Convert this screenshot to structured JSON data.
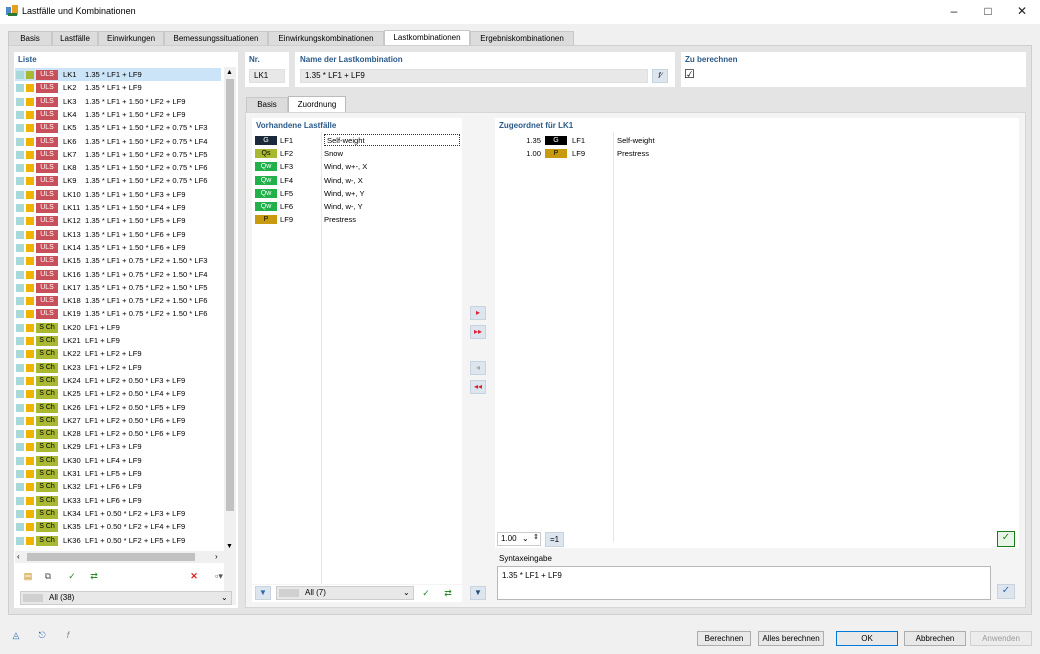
{
  "window": {
    "title": "Lastfälle und Kombinationen"
  },
  "tabs": [
    "Basis",
    "Lastfälle",
    "Einwirkungen",
    "Bemessungssituationen",
    "Einwirkungskombinationen",
    "Lastkombinationen",
    "Ergebniskombinationen"
  ],
  "list": {
    "header": "Liste",
    "items": [
      {
        "tag": "ULS",
        "name": "LK1",
        "formula": "1.35 * LF1 + LF9"
      },
      {
        "tag": "ULS",
        "name": "LK2",
        "formula": "1.35 * LF1 + LF9"
      },
      {
        "tag": "ULS",
        "name": "LK3",
        "formula": "1.35 * LF1 + 1.50 * LF2 + LF9"
      },
      {
        "tag": "ULS",
        "name": "LK4",
        "formula": "1.35 * LF1 + 1.50 * LF2 + LF9"
      },
      {
        "tag": "ULS",
        "name": "LK5",
        "formula": "1.35 * LF1 + 1.50 * LF2 + 0.75 * LF3"
      },
      {
        "tag": "ULS",
        "name": "LK6",
        "formula": "1.35 * LF1 + 1.50 * LF2 + 0.75 * LF4"
      },
      {
        "tag": "ULS",
        "name": "LK7",
        "formula": "1.35 * LF1 + 1.50 * LF2 + 0.75 * LF5"
      },
      {
        "tag": "ULS",
        "name": "LK8",
        "formula": "1.35 * LF1 + 1.50 * LF2 + 0.75 * LF6"
      },
      {
        "tag": "ULS",
        "name": "LK9",
        "formula": "1.35 * LF1 + 1.50 * LF2 + 0.75 * LF6"
      },
      {
        "tag": "ULS",
        "name": "LK10",
        "formula": "1.35 * LF1 + 1.50 * LF3 + LF9"
      },
      {
        "tag": "ULS",
        "name": "LK11",
        "formula": "1.35 * LF1 + 1.50 * LF4 + LF9"
      },
      {
        "tag": "ULS",
        "name": "LK12",
        "formula": "1.35 * LF1 + 1.50 * LF5 + LF9"
      },
      {
        "tag": "ULS",
        "name": "LK13",
        "formula": "1.35 * LF1 + 1.50 * LF6 + LF9"
      },
      {
        "tag": "ULS",
        "name": "LK14",
        "formula": "1.35 * LF1 + 1.50 * LF6 + LF9"
      },
      {
        "tag": "ULS",
        "name": "LK15",
        "formula": "1.35 * LF1 + 0.75 * LF2 + 1.50 * LF3"
      },
      {
        "tag": "ULS",
        "name": "LK16",
        "formula": "1.35 * LF1 + 0.75 * LF2 + 1.50 * LF4"
      },
      {
        "tag": "ULS",
        "name": "LK17",
        "formula": "1.35 * LF1 + 0.75 * LF2 + 1.50 * LF5"
      },
      {
        "tag": "ULS",
        "name": "LK18",
        "formula": "1.35 * LF1 + 0.75 * LF2 + 1.50 * LF6"
      },
      {
        "tag": "ULS",
        "name": "LK19",
        "formula": "1.35 * LF1 + 0.75 * LF2 + 1.50 * LF6"
      },
      {
        "tag": "S Ch",
        "name": "LK20",
        "formula": "LF1 + LF9"
      },
      {
        "tag": "S Ch",
        "name": "LK21",
        "formula": "LF1 + LF9"
      },
      {
        "tag": "S Ch",
        "name": "LK22",
        "formula": "LF1 + LF2 + LF9"
      },
      {
        "tag": "S Ch",
        "name": "LK23",
        "formula": "LF1 + LF2 + LF9"
      },
      {
        "tag": "S Ch",
        "name": "LK24",
        "formula": "LF1 + LF2 + 0.50 * LF3 + LF9"
      },
      {
        "tag": "S Ch",
        "name": "LK25",
        "formula": "LF1 + LF2 + 0.50 * LF4 + LF9"
      },
      {
        "tag": "S Ch",
        "name": "LK26",
        "formula": "LF1 + LF2 + 0.50 * LF5 + LF9"
      },
      {
        "tag": "S Ch",
        "name": "LK27",
        "formula": "LF1 + LF2 + 0.50 * LF6 + LF9"
      },
      {
        "tag": "S Ch",
        "name": "LK28",
        "formula": "LF1 + LF2 + 0.50 * LF6 + LF9"
      },
      {
        "tag": "S Ch",
        "name": "LK29",
        "formula": "LF1 + LF3 + LF9"
      },
      {
        "tag": "S Ch",
        "name": "LK30",
        "formula": "LF1 + LF4 + LF9"
      },
      {
        "tag": "S Ch",
        "name": "LK31",
        "formula": "LF1 + LF5 + LF9"
      },
      {
        "tag": "S Ch",
        "name": "LK32",
        "formula": "LF1 + LF6 + LF9"
      },
      {
        "tag": "S Ch",
        "name": "LK33",
        "formula": "LF1 + LF6 + LF9"
      },
      {
        "tag": "S Ch",
        "name": "LK34",
        "formula": "LF1 + 0.50 * LF2 + LF3 + LF9"
      },
      {
        "tag": "S Ch",
        "name": "LK35",
        "formula": "LF1 + 0.50 * LF2 + LF4 + LF9"
      },
      {
        "tag": "S Ch",
        "name": "LK36",
        "formula": "LF1 + 0.50 * LF2 + LF5 + LF9"
      }
    ],
    "filter": "All (38)"
  },
  "detail": {
    "nr_label": "Nr.",
    "nr_value": "LK1",
    "name_label": "Name der Lastkombination",
    "name_value": "1.35 * LF1 + LF9",
    "calc_label": "Zu berechnen",
    "calc_checked": "☑"
  },
  "subtabs": [
    "Basis",
    "Zuordnung"
  ],
  "available": {
    "header": "Vorhandene Lastfälle",
    "items": [
      {
        "tag": "G",
        "tagcolor": "#1a2a3a",
        "tagtext": "#fff",
        "lf": "LF1",
        "desc": "Self-weight"
      },
      {
        "tag": "Qs",
        "tagcolor": "#a8b830",
        "tagtext": "#000",
        "lf": "LF2",
        "desc": "Snow"
      },
      {
        "tag": "Qw",
        "tagcolor": "#22b04a",
        "tagtext": "#fff",
        "lf": "LF3",
        "desc": "Wind, w+-, X"
      },
      {
        "tag": "Qw",
        "tagcolor": "#22b04a",
        "tagtext": "#fff",
        "lf": "LF4",
        "desc": "Wind, w-, X"
      },
      {
        "tag": "Qw",
        "tagcolor": "#22b04a",
        "tagtext": "#fff",
        "lf": "LF5",
        "desc": "Wind, w+, Y"
      },
      {
        "tag": "Qw",
        "tagcolor": "#22b04a",
        "tagtext": "#fff",
        "lf": "LF6",
        "desc": "Wind, w-, Y"
      },
      {
        "tag": "P",
        "tagcolor": "#c89a10",
        "tagtext": "#000",
        "lf": "LF9",
        "desc": "Prestress"
      }
    ],
    "filter": "All (7)"
  },
  "assigned": {
    "header": "Zugeordnet für LK1",
    "items": [
      {
        "factor": "1.35",
        "tag": "G",
        "tagcolor": "#000",
        "tagtext": "#fff",
        "lf": "LF1",
        "desc": "Self-weight"
      },
      {
        "factor": "1.00",
        "tag": "P",
        "tagcolor": "#c89a10",
        "tagtext": "#000",
        "lf": "LF9",
        "desc": "Prestress"
      }
    ],
    "factor_input": "1.00",
    "eq_button": "=1",
    "syntax_label": "Syntaxeingabe",
    "syntax_value": "1.35 * LF1 + LF9"
  },
  "buttons": {
    "calc": "Berechnen",
    "calc_all": "Alles berechnen",
    "ok": "OK",
    "cancel": "Abbrechen",
    "apply": "Anwenden"
  }
}
